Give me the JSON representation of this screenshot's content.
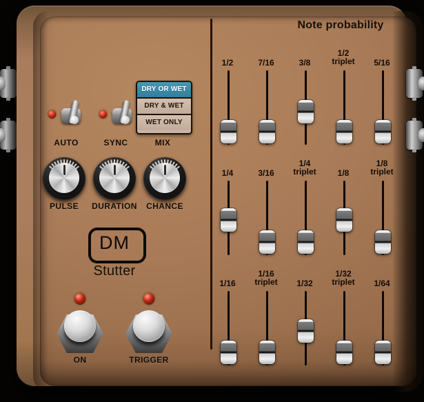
{
  "device": {
    "brand": "DM",
    "model": "Stutter"
  },
  "header": {
    "title": "Note probability"
  },
  "controls": {
    "toggles": [
      {
        "label": "AUTO",
        "state": "on",
        "led": "on"
      },
      {
        "label": "SYNC",
        "state": "on",
        "led": "on"
      }
    ],
    "mix": {
      "label": "MIX",
      "options": [
        "DRY OR WET",
        "DRY & WET",
        "WET ONLY"
      ],
      "selected": "DRY OR WET",
      "selected_color": "#3a8fae"
    },
    "knobs": [
      {
        "label": "PULSE",
        "value": 50
      },
      {
        "label": "DURATION",
        "value": 50
      },
      {
        "label": "CHANCE",
        "value": 50
      }
    ],
    "footswitches": [
      {
        "label": "ON",
        "led": "on"
      },
      {
        "label": "TRIGGER",
        "led": "on"
      }
    ]
  },
  "note_probability": {
    "rows": [
      {
        "sliders": [
          {
            "label": "1/2",
            "value": 3
          },
          {
            "label": "7/16",
            "value": 3
          },
          {
            "label": "3/8",
            "value": 42
          },
          {
            "label": "1/2\ntriplet",
            "value": 3
          },
          {
            "label": "5/16",
            "value": 3
          }
        ]
      },
      {
        "sliders": [
          {
            "label": "1/4",
            "value": 46
          },
          {
            "label": "3/16",
            "value": 3
          },
          {
            "label": "1/4\ntriplet",
            "value": 3
          },
          {
            "label": "1/8",
            "value": 46
          },
          {
            "label": "1/8\ntriplet",
            "value": 3
          }
        ]
      },
      {
        "sliders": [
          {
            "label": "1/16",
            "value": 3
          },
          {
            "label": "1/16\ntriplet",
            "value": 3
          },
          {
            "label": "1/32",
            "value": 44
          },
          {
            "label": "1/32\ntriplet",
            "value": 3
          },
          {
            "label": "1/64",
            "value": 3
          }
        ]
      }
    ]
  },
  "jacks": {
    "left": [
      "jack-socket",
      "jack-socket"
    ],
    "right": [
      "jack-socket",
      "jack-socket"
    ]
  },
  "colors": {
    "enclosure": "#a87a57",
    "accent": "#3a8fae",
    "led": "#c42c16",
    "text": "#120c06"
  }
}
